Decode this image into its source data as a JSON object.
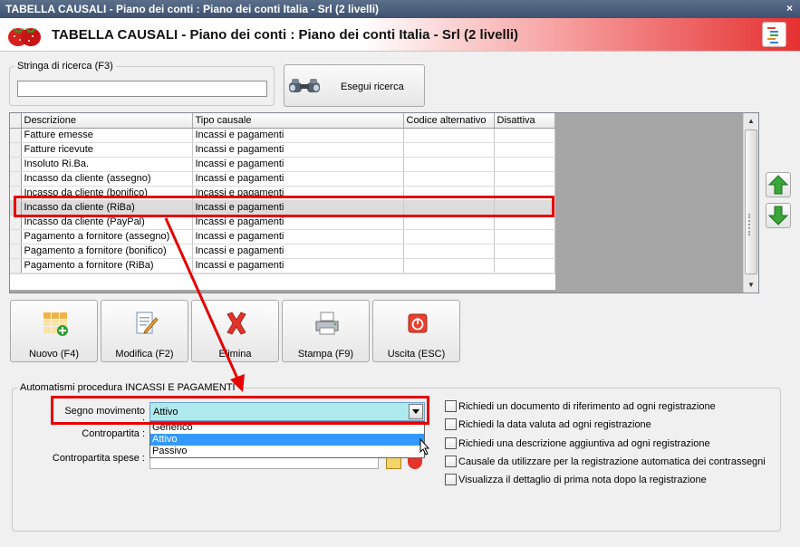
{
  "window": {
    "title": "TABELLA CAUSALI - Piano dei conti : Piano dei conti Italia - Srl (2 livelli)",
    "close_glyph": "×"
  },
  "header": {
    "title": "TABELLA CAUSALI - Piano dei conti : Piano dei conti Italia - Srl (2 livelli)"
  },
  "search": {
    "legend": "Stringa di ricerca (F3)",
    "value": "",
    "button_label": "Esegui ricerca"
  },
  "grid": {
    "columns": [
      "Descrizione",
      "Tipo causale",
      "Codice alternativo",
      "Disattiva"
    ],
    "rows": [
      [
        "Fatture emesse",
        "Incassi e pagamenti",
        "",
        ""
      ],
      [
        "Fatture ricevute",
        "Incassi e pagamenti",
        "",
        ""
      ],
      [
        "Insoluto Ri.Ba.",
        "Incassi e pagamenti",
        "",
        ""
      ],
      [
        "Incasso da cliente (assegno)",
        "Incassi e pagamenti",
        "",
        ""
      ],
      [
        "Incasso da cliente (bonifico)",
        "Incassi e pagamenti",
        "",
        ""
      ],
      [
        "Incasso da cliente (RiBa)",
        "Incassi e pagamenti",
        "",
        ""
      ],
      [
        "Incasso da cliente (PayPal)",
        "Incassi e pagamenti",
        "",
        ""
      ],
      [
        "Pagamento a fornitore (assegno)",
        "Incassi e pagamenti",
        "",
        ""
      ],
      [
        "Pagamento a fornitore (bonifico)",
        "Incassi e pagamenti",
        "",
        ""
      ],
      [
        "Pagamento a fornitore (RiBa)",
        "Incassi e pagamenti",
        "",
        ""
      ]
    ],
    "selected_row": 5
  },
  "toolbar": {
    "new_label": "Nuovo (F4)",
    "edit_label": "Modifica (F2)",
    "delete_label": "Elimina",
    "print_label": "Stampa (F9)",
    "exit_label": "Uscita (ESC)"
  },
  "automatismi": {
    "legend": "Automatismi procedura INCASSI E PAGAMENTI",
    "segno_label": "Segno movimento :",
    "segno_value": "Attivo",
    "segno_options": [
      "Generico",
      "Attivo",
      "Passivo"
    ],
    "contropartita_label": "Contropartita :",
    "contropartita_spese_label": "Contropartita spese :",
    "checks": [
      "Richiedi un documento di riferimento ad ogni registrazione",
      "Richiedi la data valuta ad ogni registrazione",
      "Richiedi una descrizione aggiuntiva ad ogni registrazione",
      "Causale da utilizzare per la registrazione automatica dei contrassegni",
      "Visualizza il dettaglio di prima nota dopo la registrazione"
    ],
    "checked": [
      false,
      false,
      false,
      false,
      false
    ]
  },
  "colors": {
    "highlight": "#e60000",
    "combo_bg": "#aee9ee",
    "dropdown_selected": "#3399ff",
    "header_red": "#e53030"
  },
  "icons": [
    "strawberry-logo-icon",
    "menu-list-icon",
    "binoculars-icon",
    "new-grid-icon",
    "edit-document-icon",
    "delete-x-icon",
    "printer-icon",
    "power-icon",
    "arrow-up-icon",
    "arrow-down-icon"
  ]
}
